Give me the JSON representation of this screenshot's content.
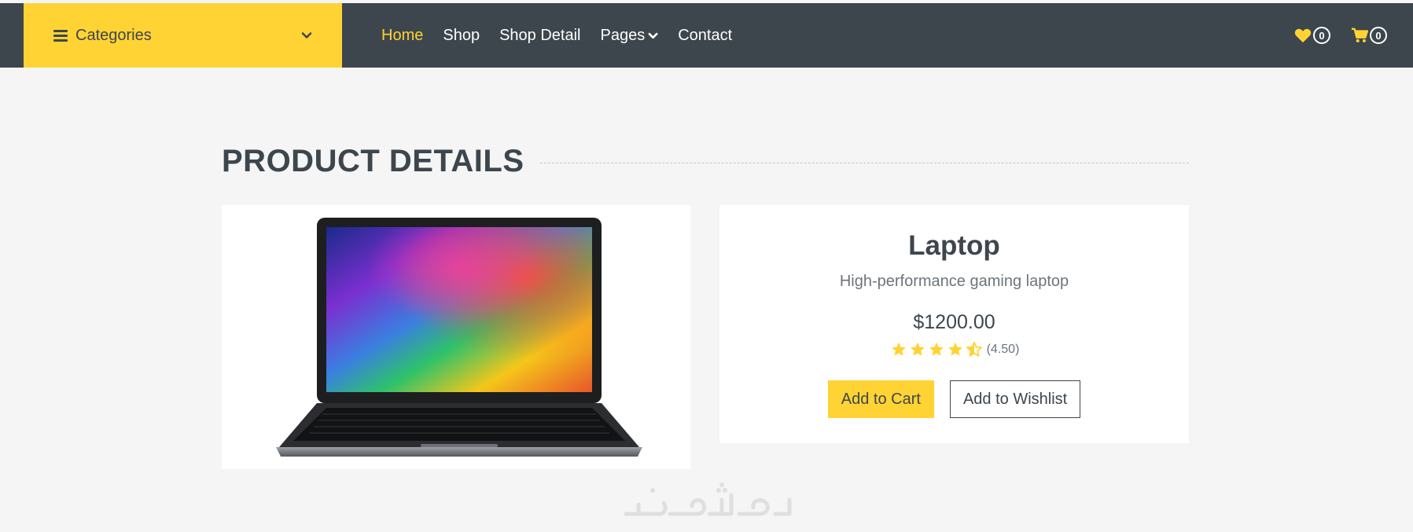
{
  "navbar": {
    "categories_label": "Categories",
    "links": [
      {
        "label": "Home",
        "active": true
      },
      {
        "label": "Shop",
        "active": false
      },
      {
        "label": "Shop Detail",
        "active": false
      },
      {
        "label": "Pages",
        "active": false,
        "dropdown": true
      },
      {
        "label": "Contact",
        "active": false
      }
    ],
    "wishlist_count": "0",
    "cart_count": "0"
  },
  "section": {
    "title": "PRODUCT DETAILS"
  },
  "product": {
    "name": "Laptop",
    "description": "High-performance gaming laptop",
    "price": "$1200.00",
    "rating_text": "(4.50)",
    "rating_value": 4.5,
    "add_to_cart_label": "Add to Cart",
    "add_to_wishlist_label": "Add to Wishlist"
  },
  "colors": {
    "dark": "#3d464d",
    "accent": "#ffd333",
    "background": "#f5f5f5"
  },
  "icons": {
    "menu": "bars-icon",
    "dropdown": "chevron-down-icon",
    "wishlist": "heart-icon",
    "cart": "shopping-cart-icon",
    "star": "star-icon"
  }
}
